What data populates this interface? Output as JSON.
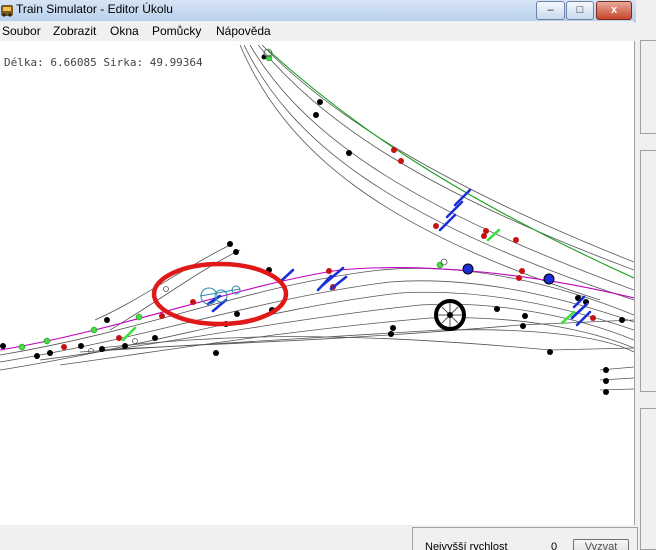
{
  "window": {
    "title": "Train Simulator - Editor Úkolu",
    "minimize_glyph": "–",
    "maximize_glyph": "□",
    "close_glyph": "x"
  },
  "menu": [
    {
      "label": "Soubor"
    },
    {
      "label": "Zobrazit"
    },
    {
      "label": "Okna"
    },
    {
      "label": "Pomůcky"
    },
    {
      "label": "Nápověda"
    }
  ],
  "canvas": {
    "coordinates": "Délka: 6.66085 Sirka: 49.99364"
  },
  "bottom_panel": {
    "label": "Nejvyšší rychlost",
    "value": "0",
    "button_label": "Vyzvat"
  },
  "colors": {
    "track": "#555555",
    "main_line_green": "#1aa01a",
    "main_line_magenta": "#c000c0",
    "highlight_circle": "#e01818",
    "signal_blue": "#1c2fd6",
    "marker_green": "#3fe03f",
    "marker_red": "#c81010"
  },
  "icons": {
    "app": "train-simulator-app-icon",
    "waypoint": "wheel-waypoint-icon"
  }
}
